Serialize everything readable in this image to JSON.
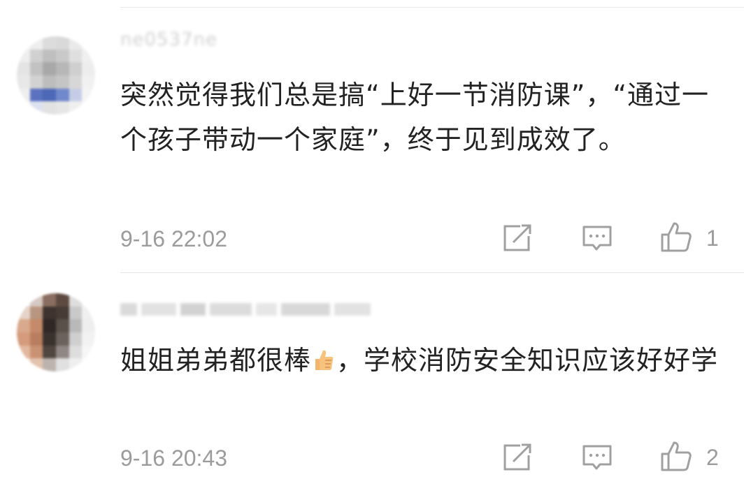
{
  "comments": [
    {
      "username": "ne0537ne",
      "text_parts": [
        "突然觉得我们总是搞“上好一节消防课”，“通过一个孩子带动一个家庭”，终于见到成效了。"
      ],
      "timestamp": "9-16 22:02",
      "like_count": "1",
      "icons": {
        "share": "share-icon",
        "reply": "comment-icon",
        "like": "thumbs-up-icon"
      }
    },
    {
      "username": "",
      "text_before_emoji": "姐姐弟弟都很棒",
      "emoji": "thumbs-up-emoji",
      "text_after_emoji": "，学校消防安全知识应该好好学",
      "timestamp": "9-16 20:43",
      "like_count": "2",
      "icons": {
        "share": "share-icon",
        "reply": "comment-icon",
        "like": "thumbs-up-icon"
      }
    }
  ],
  "colors": {
    "text": "#222222",
    "meta": "#9b9b9b",
    "divider": "#e6e6e6",
    "icon": "#a0a0a0"
  }
}
